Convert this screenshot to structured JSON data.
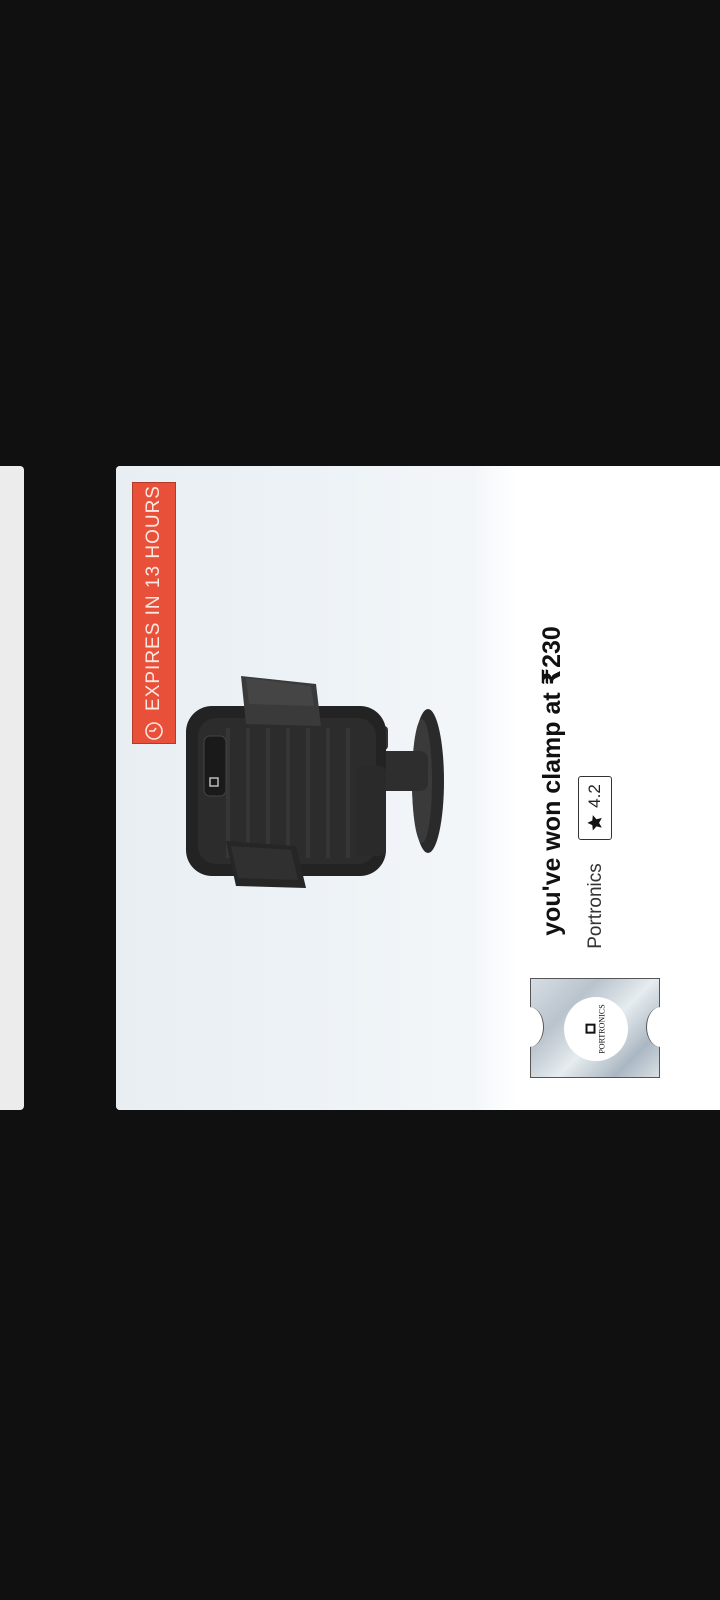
{
  "offer": {
    "expiry_text": "EXPIRES IN 13 HOURS",
    "title": "you've won clamp at ₹230",
    "brand": "Portronics",
    "rating": "4.2",
    "brand_logo_text": "PORTRONICS",
    "product_logo_text": "PORTRONICS"
  },
  "colors": {
    "background": "#101010",
    "expiry_banner": "#e8503a",
    "card": "#ffffff"
  },
  "icons": {
    "expiry": "clock-icon",
    "rating": "star-icon"
  }
}
